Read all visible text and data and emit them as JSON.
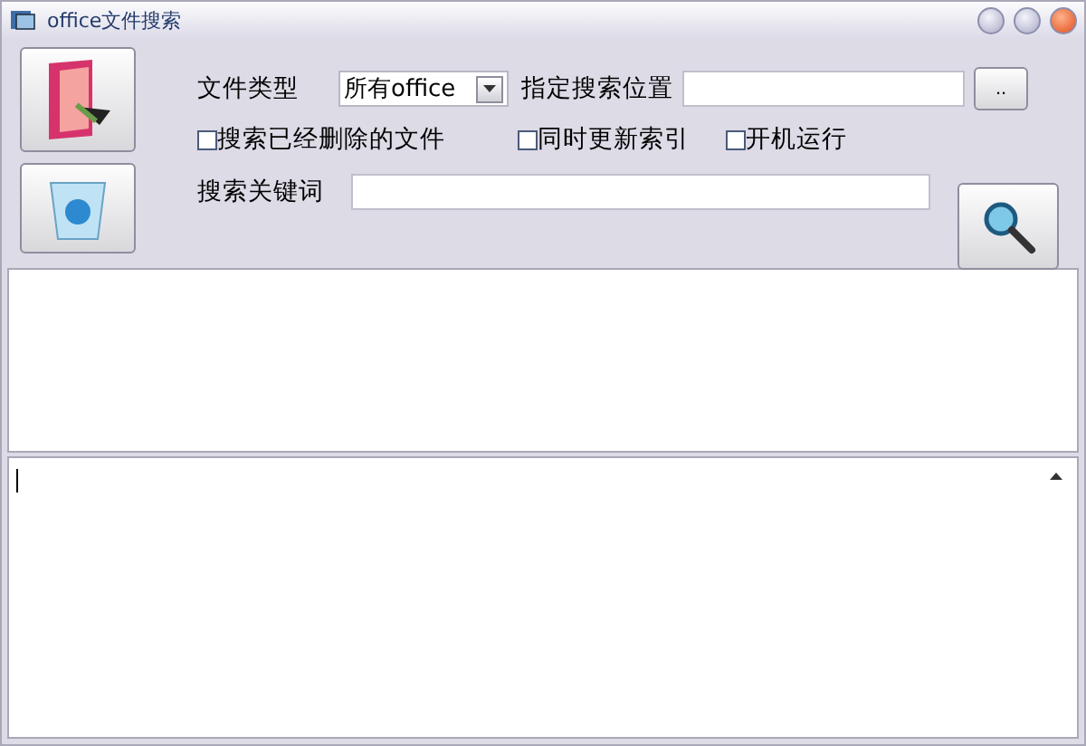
{
  "window": {
    "title": "office文件搜索"
  },
  "file_type": {
    "label": "文件类型",
    "value": "所有office"
  },
  "location": {
    "label": "指定搜索位置",
    "browse": ".."
  },
  "options": [
    {
      "label": "搜索已经删除的文件",
      "checked": false
    },
    {
      "label": "同时更新索引",
      "checked": false
    },
    {
      "label": "开机运行",
      "checked": false
    }
  ],
  "keyword": {
    "label": "搜索关键词"
  }
}
